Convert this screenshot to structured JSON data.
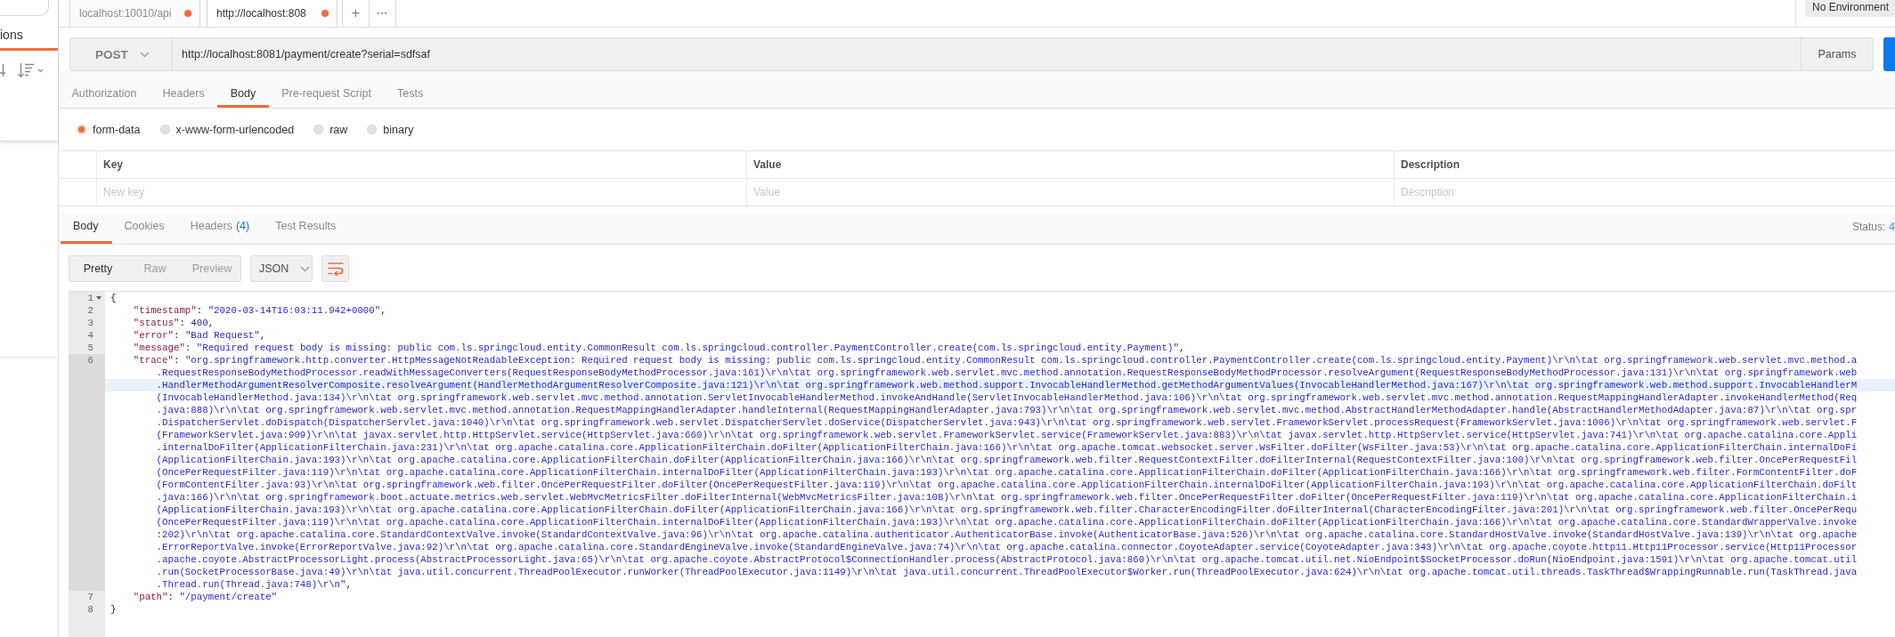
{
  "sidebar": {
    "tabs": [
      {
        "label": "ions",
        "selected": true
      }
    ]
  },
  "tab_bar": {
    "tabs": [
      {
        "title": "localhost:10010/api",
        "selected": false,
        "unsaved": true
      },
      {
        "title": "http://localhost:808",
        "selected": true,
        "unsaved": true
      }
    ],
    "add_label": "+",
    "more_label": "•••",
    "environment": "No Environment"
  },
  "request": {
    "method": "POST",
    "url": "http://localhost:8081/payment/create?serial=sdfsaf",
    "params_label": "Params",
    "tabs": [
      {
        "label": "Authorization",
        "selected": false
      },
      {
        "label": "Headers",
        "selected": false
      },
      {
        "label": "Body",
        "selected": true
      },
      {
        "label": "Pre-request Script",
        "selected": false
      },
      {
        "label": "Tests",
        "selected": false
      }
    ],
    "body_modes": [
      {
        "label": "form-data",
        "selected": true
      },
      {
        "label": "x-www-form-urlencoded",
        "selected": false
      },
      {
        "label": "raw",
        "selected": false
      },
      {
        "label": "binary",
        "selected": false
      }
    ],
    "table": {
      "columns": [
        "Key",
        "Value",
        "Description"
      ],
      "new_row": [
        {
          "placeholder": "New key"
        },
        {
          "placeholder": "Value"
        },
        {
          "placeholder": "Description"
        }
      ]
    }
  },
  "response": {
    "tabs": [
      {
        "label": "Body",
        "selected": true
      },
      {
        "label": "Cookies",
        "selected": false
      },
      {
        "label": "Headers",
        "count": "(4)",
        "selected": false
      },
      {
        "label": "Test Results",
        "selected": false
      }
    ],
    "status": {
      "label": "Status:",
      "value": "4"
    },
    "views": [
      {
        "label": "Pretty",
        "selected": true
      },
      {
        "label": "Raw",
        "selected": false
      },
      {
        "label": "Preview",
        "selected": false
      }
    ],
    "format": "JSON",
    "wrap": true,
    "editor": {
      "lines": [
        {
          "number": "1",
          "fold": true,
          "active": false,
          "nested": false,
          "rows": [
            {
              "highlighted": false,
              "segments": [
                {
                  "kind": "punct",
                  "text": "{"
                }
              ]
            }
          ]
        },
        {
          "number": "2",
          "fold": false,
          "active": false,
          "nested": true,
          "rows": [
            {
              "highlighted": false,
              "segments": [
                {
                  "kind": "key",
                  "text": "\"timestamp\""
                },
                {
                  "kind": "punct",
                  "text": ": "
                },
                {
                  "kind": "string",
                  "text": "\"2020-03-14T16:03:11.942+0000\""
                },
                {
                  "kind": "punct",
                  "text": ","
                }
              ]
            }
          ]
        },
        {
          "number": "3",
          "fold": false,
          "active": false,
          "nested": true,
          "rows": [
            {
              "highlighted": false,
              "segments": [
                {
                  "kind": "key",
                  "text": "\"status\""
                },
                {
                  "kind": "punct",
                  "text": ": "
                },
                {
                  "kind": "number",
                  "text": "400"
                },
                {
                  "kind": "punct",
                  "text": ","
                }
              ]
            }
          ]
        },
        {
          "number": "4",
          "fold": false,
          "active": false,
          "nested": true,
          "rows": [
            {
              "highlighted": false,
              "segments": [
                {
                  "kind": "key",
                  "text": "\"error\""
                },
                {
                  "kind": "punct",
                  "text": ": "
                },
                {
                  "kind": "string",
                  "text": "\"Bad Request\""
                },
                {
                  "kind": "punct",
                  "text": ","
                }
              ]
            }
          ]
        },
        {
          "number": "5",
          "fold": false,
          "active": false,
          "nested": true,
          "rows": [
            {
              "highlighted": false,
              "segments": [
                {
                  "kind": "key",
                  "text": "\"message\""
                },
                {
                  "kind": "punct",
                  "text": ": "
                },
                {
                  "kind": "string",
                  "text": "\"Required request body is missing: public com.ls.springcloud.entity.CommonResult com.ls.springcloud.controller.PaymentController.create(com.ls.springcloud.entity.Payment)\""
                },
                {
                  "kind": "punct",
                  "text": ","
                }
              ]
            }
          ]
        },
        {
          "number": "6",
          "fold": false,
          "active": true,
          "nested": true,
          "rows": [
            {
              "highlighted": false,
              "segments": [
                {
                  "kind": "key",
                  "text": "\"trace\""
                },
                {
                  "kind": "punct",
                  "text": ": "
                },
                {
                  "kind": "string",
                  "text": "\"org.springframework.http.converter.HttpMessageNotReadableException: Required request body is missing: public com.ls.springcloud.entity.CommonResult com.ls.springcloud.controller.PaymentController.create(com.ls.springcloud.entity.Payment)\\r\\n\\tat org.springframework.web.servlet.mvc.method.a"
                }
              ]
            },
            {
              "highlighted": false,
              "segments": [
                {
                  "kind": "string",
                  "text": ".RequestResponseBodyMethodProcessor.readWithMessageConverters(RequestResponseBodyMethodProcessor.java:161)\\r\\n\\tat org.springframework.web.servlet.mvc.method.annotation.RequestResponseBodyMethodProcessor.resolveArgument(RequestResponseBodyMethodProcessor.java:131)\\r\\n\\tat org.springframework.web"
                }
              ]
            },
            {
              "highlighted": true,
              "segments": [
                {
                  "kind": "string",
                  "text": ".HandlerMethodArgumentResolverComposite.resolveArgument(HandlerMethodArgumentResolverComposite.java:121)\\r\\n\\tat org.springframework.web.method.support.InvocableHandlerMethod.getMethodArgumentValues(InvocableHandlerMethod.java:167)\\r\\n\\tat org.springframework.web.method.support.InvocableHandlerM"
                }
              ]
            },
            {
              "highlighted": false,
              "segments": [
                {
                  "kind": "string",
                  "text": "(InvocableHandlerMethod.java:134)\\r\\n\\tat org.springframework.web.servlet.mvc.method.annotation.ServletInvocableHandlerMethod.invokeAndHandle(ServletInvocableHandlerMethod.java:106)\\r\\n\\tat org.springframework.web.servlet.mvc.method.annotation.RequestMappingHandlerAdapter.invokeHandlerMethod(Req"
                }
              ]
            },
            {
              "highlighted": false,
              "segments": [
                {
                  "kind": "string",
                  "text": ".java:888)\\r\\n\\tat org.springframework.web.servlet.mvc.method.annotation.RequestMappingHandlerAdapter.handleInternal(RequestMappingHandlerAdapter.java:793)\\r\\n\\tat org.springframework.web.servlet.mvc.method.AbstractHandlerMethodAdapter.handle(AbstractHandlerMethodAdapter.java:87)\\r\\n\\tat org.spr"
                }
              ]
            },
            {
              "highlighted": false,
              "segments": [
                {
                  "kind": "string",
                  "text": ".DispatcherServlet.doDispatch(DispatcherServlet.java:1040)\\r\\n\\tat org.springframework.web.servlet.DispatcherServlet.doService(DispatcherServlet.java:943)\\r\\n\\tat org.springframework.web.servlet.FrameworkServlet.processRequest(FrameworkServlet.java:1006)\\r\\n\\tat org.springframework.web.servlet.F"
                }
              ]
            },
            {
              "highlighted": false,
              "segments": [
                {
                  "kind": "string",
                  "text": "(FrameworkServlet.java:909)\\r\\n\\tat javax.servlet.http.HttpServlet.service(HttpServlet.java:660)\\r\\n\\tat org.springframework.web.servlet.FrameworkServlet.service(FrameworkServlet.java:883)\\r\\n\\tat javax.servlet.http.HttpServlet.service(HttpServlet.java:741)\\r\\n\\tat org.apache.catalina.core.Appli"
                }
              ]
            },
            {
              "highlighted": false,
              "segments": [
                {
                  "kind": "string",
                  "text": ".internalDoFilter(ApplicationFilterChain.java:231)\\r\\n\\tat org.apache.catalina.core.ApplicationFilterChain.doFilter(ApplicationFilterChain.java:166)\\r\\n\\tat org.apache.tomcat.websocket.server.WsFilter.doFilter(WsFilter.java:53)\\r\\n\\tat org.apache.catalina.core.ApplicationFilterChain.internalDoFi"
                }
              ]
            },
            {
              "highlighted": false,
              "segments": [
                {
                  "kind": "string",
                  "text": "(ApplicationFilterChain.java:193)\\r\\n\\tat org.apache.catalina.core.ApplicationFilterChain.doFilter(ApplicationFilterChain.java:166)\\r\\n\\tat org.springframework.web.filter.RequestContextFilter.doFilterInternal(RequestContextFilter.java:100)\\r\\n\\tat org.springframework.web.filter.OncePerRequestFil"
                }
              ]
            },
            {
              "highlighted": false,
              "segments": [
                {
                  "kind": "string",
                  "text": "(OncePerRequestFilter.java:119)\\r\\n\\tat org.apache.catalina.core.ApplicationFilterChain.internalDoFilter(ApplicationFilterChain.java:193)\\r\\n\\tat org.apache.catalina.core.ApplicationFilterChain.doFilter(ApplicationFilterChain.java:166)\\r\\n\\tat org.springframework.web.filter.FormContentFilter.doF"
                }
              ]
            },
            {
              "highlighted": false,
              "segments": [
                {
                  "kind": "string",
                  "text": "(FormContentFilter.java:93)\\r\\n\\tat org.springframework.web.filter.OncePerRequestFilter.doFilter(OncePerRequestFilter.java:119)\\r\\n\\tat org.apache.catalina.core.ApplicationFilterChain.internalDoFilter(ApplicationFilterChain.java:193)\\r\\n\\tat org.apache.catalina.core.ApplicationFilterChain.doFilt"
                }
              ]
            },
            {
              "highlighted": false,
              "segments": [
                {
                  "kind": "string",
                  "text": ".java:166)\\r\\n\\tat org.springframework.boot.actuate.metrics.web.servlet.WebMvcMetricsFilter.doFilterInternal(WebMvcMetricsFilter.java:108)\\r\\n\\tat org.springframework.web.filter.OncePerRequestFilter.doFilter(OncePerRequestFilter.java:119)\\r\\n\\tat org.apache.catalina.core.ApplicationFilterChain.i"
                }
              ]
            },
            {
              "highlighted": false,
              "segments": [
                {
                  "kind": "string",
                  "text": "(ApplicationFilterChain.java:193)\\r\\n\\tat org.apache.catalina.core.ApplicationFilterChain.doFilter(ApplicationFilterChain.java:166)\\r\\n\\tat org.springframework.web.filter.CharacterEncodingFilter.doFilterInternal(CharacterEncodingFilter.java:201)\\r\\n\\tat org.springframework.web.filter.OncePerRequ"
                }
              ]
            },
            {
              "highlighted": false,
              "segments": [
                {
                  "kind": "string",
                  "text": "(OncePerRequestFilter.java:119)\\r\\n\\tat org.apache.catalina.core.ApplicationFilterChain.internalDoFilter(ApplicationFilterChain.java:193)\\r\\n\\tat org.apache.catalina.core.ApplicationFilterChain.doFilter(ApplicationFilterChain.java:166)\\r\\n\\tat org.apache.catalina.core.StandardWrapperValve.invoke"
                }
              ]
            },
            {
              "highlighted": false,
              "segments": [
                {
                  "kind": "string",
                  "text": ":202)\\r\\n\\tat org.apache.catalina.core.StandardContextValve.invoke(StandardContextValve.java:96)\\r\\n\\tat org.apache.catalina.authenticator.AuthenticatorBase.invoke(AuthenticatorBase.java:526)\\r\\n\\tat org.apache.catalina.core.StandardHostValve.invoke(StandardHostValve.java:139)\\r\\n\\tat org.apache"
                }
              ]
            },
            {
              "highlighted": false,
              "segments": [
                {
                  "kind": "string",
                  "text": ".ErrorReportValve.invoke(ErrorReportValve.java:92)\\r\\n\\tat org.apache.catalina.core.StandardEngineValve.invoke(StandardEngineValve.java:74)\\r\\n\\tat org.apache.catalina.connector.CoyoteAdapter.service(CoyoteAdapter.java:343)\\r\\n\\tat org.apache.coyote.http11.Http11Processor.service(Http11Processor"
                }
              ]
            },
            {
              "highlighted": false,
              "segments": [
                {
                  "kind": "string",
                  "text": ".apache.coyote.AbstractProcessorLight.process(AbstractProcessorLight.java:65)\\r\\n\\tat org.apache.coyote.AbstractProtocol$ConnectionHandler.process(AbstractProtocol.java:860)\\r\\n\\tat org.apache.tomcat.util.net.NioEndpoint$SocketProcessor.doRun(NioEndpoint.java:1591)\\r\\n\\tat org.apache.tomcat.util"
                }
              ]
            },
            {
              "highlighted": false,
              "segments": [
                {
                  "kind": "string",
                  "text": ".run(SocketProcessorBase.java:49)\\r\\n\\tat java.util.concurrent.ThreadPoolExecutor.runWorker(ThreadPoolExecutor.java:1149)\\r\\n\\tat java.util.concurrent.ThreadPoolExecutor$Worker.run(ThreadPoolExecutor.java:624)\\r\\n\\tat org.apache.tomcat.util.threads.TaskThread$WrappingRunnable.run(TaskThread.java"
                }
              ]
            },
            {
              "highlighted": false,
              "segments": [
                {
                  "kind": "string",
                  "text": ".Thread.run(Thread.java:748)\\r\\n\""
                },
                {
                  "kind": "punct",
                  "text": ","
                }
              ]
            }
          ]
        },
        {
          "number": "7",
          "fold": false,
          "active": false,
          "nested": true,
          "rows": [
            {
              "highlighted": false,
              "segments": [
                {
                  "kind": "key",
                  "text": "\"path\""
                },
                {
                  "kind": "punct",
                  "text": ": "
                },
                {
                  "kind": "string",
                  "text": "\"/payment/create\""
                }
              ]
            }
          ]
        },
        {
          "number": "8",
          "fold": false,
          "active": false,
          "nested": false,
          "rows": [
            {
              "highlighted": false,
              "segments": [
                {
                  "kind": "punct",
                  "text": "}"
                }
              ]
            }
          ]
        }
      ]
    }
  }
}
